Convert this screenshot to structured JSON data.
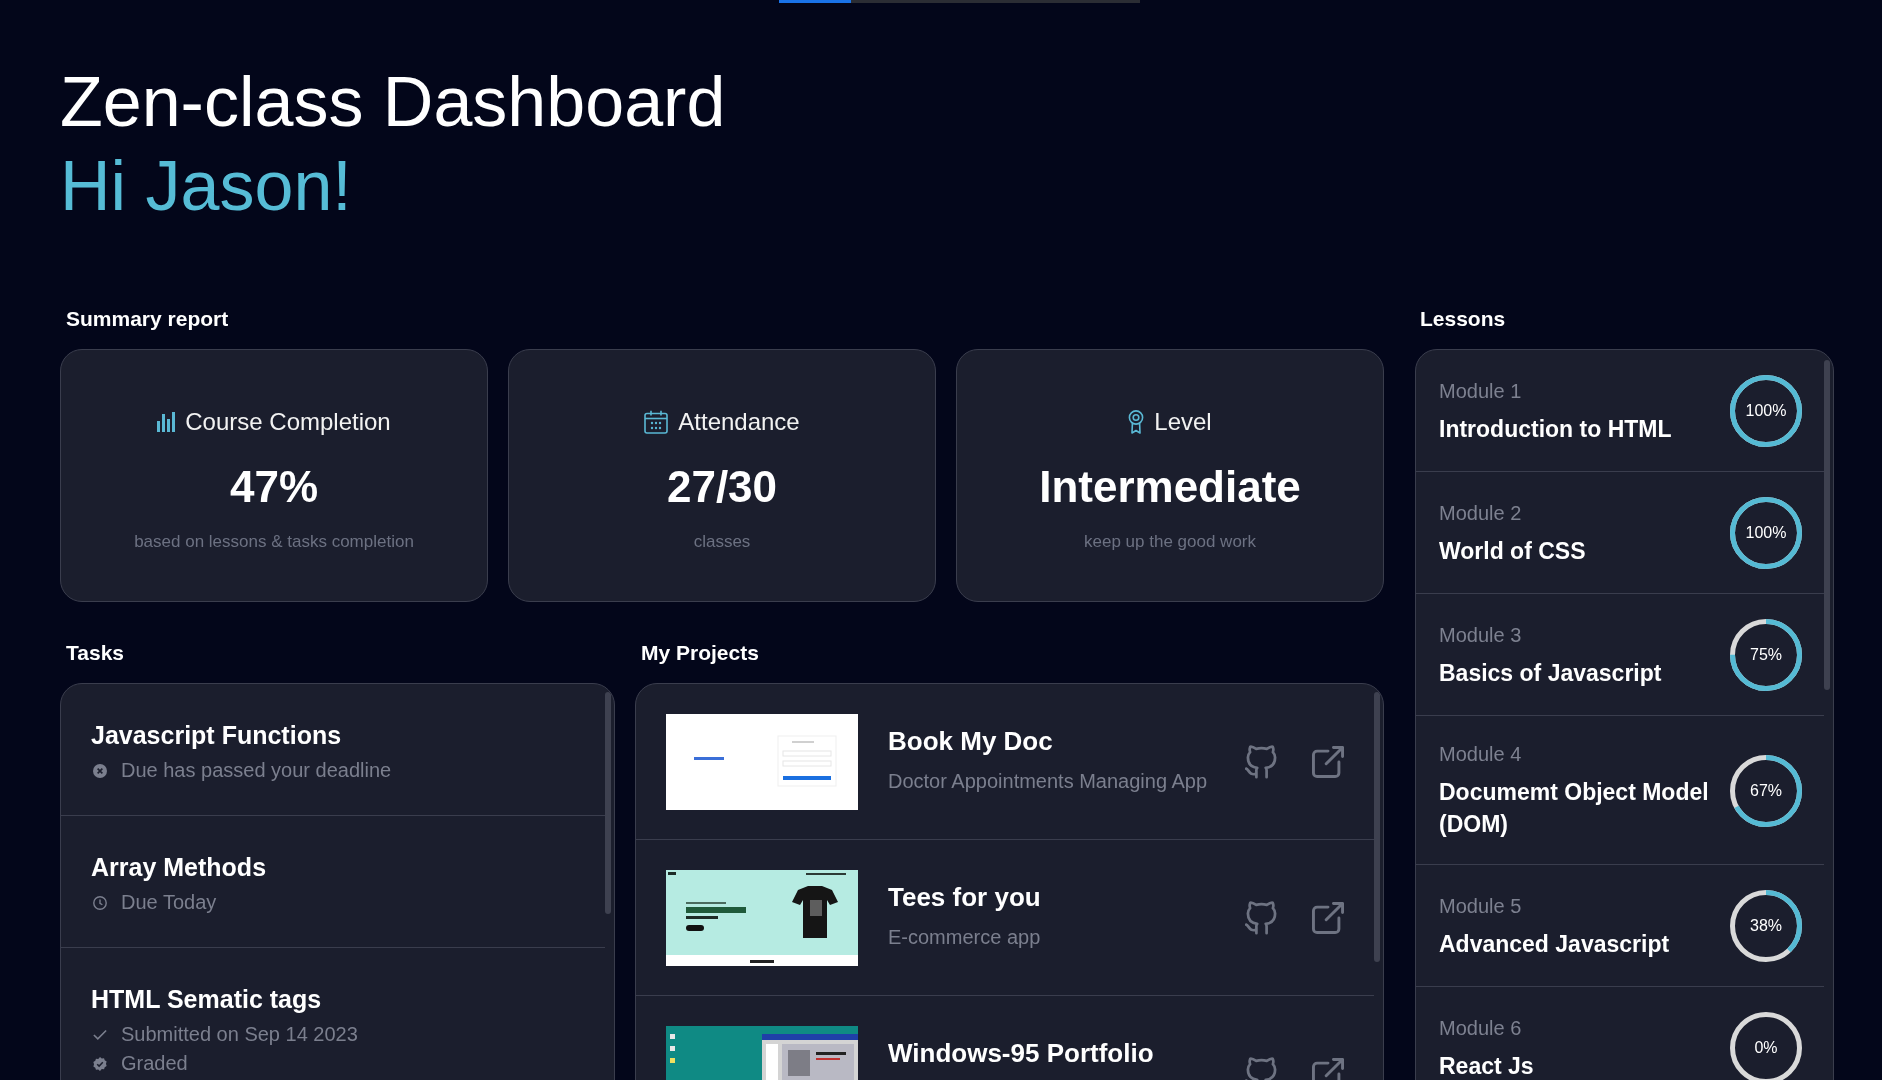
{
  "loading_bar": {
    "level": 0.2
  },
  "header": {
    "title": "Zen-class Dashboard",
    "greeting": "Hi Jason!"
  },
  "summary": {
    "heading": "Summary report",
    "cards": [
      {
        "kind": "completion",
        "label": "Course Completion",
        "value": "47%",
        "note": "based on lessons & tasks completion"
      },
      {
        "kind": "attendance",
        "label": "Attendance",
        "value": "27/30",
        "note": "classes"
      },
      {
        "kind": "level",
        "label": "Level",
        "value": "Intermediate",
        "note": "keep up the good work"
      }
    ]
  },
  "tasks": {
    "heading": "Tasks",
    "items": [
      {
        "title": "Javascript Functions",
        "status": [
          {
            "kind": "overdue",
            "text": "Due has passed your deadline"
          }
        ]
      },
      {
        "title": "Array Methods",
        "status": [
          {
            "kind": "due",
            "text": "Due Today"
          }
        ]
      },
      {
        "title": "HTML Sematic tags",
        "status": [
          {
            "kind": "submitted",
            "text": "Submitted on Sep 14 2023"
          },
          {
            "kind": "graded",
            "text": "Graded"
          }
        ]
      }
    ]
  },
  "projects": {
    "heading": "My Projects",
    "items": [
      {
        "kind": "form",
        "title": "Book My Doc",
        "description": "Doctor Appointments Managing App"
      },
      {
        "kind": "shop",
        "title": "Tees for you",
        "description": "E-commerce app"
      },
      {
        "kind": "desktop",
        "title": "Windows-95 Portfolio"
      }
    ]
  },
  "lessons": {
    "heading": "Lessons",
    "items": [
      {
        "module": "Module 1",
        "title": "Introduction to HTML",
        "level": 1,
        "progress": "100%"
      },
      {
        "module": "Module 2",
        "title": "World of CSS",
        "level": 1,
        "progress": "100%"
      },
      {
        "module": "Module 3",
        "title": "Basics of Javascript",
        "level": 0.75,
        "progress": "75%"
      },
      {
        "module": "Module 4",
        "title": "Documemt Object Model (DOM)",
        "level": 0.67,
        "progress": "67%"
      },
      {
        "module": "Module 5",
        "title": "Advanced Javascript",
        "level": 0.38,
        "progress": "38%"
      },
      {
        "module": "Module 6",
        "title": "React Js",
        "level": 0,
        "progress": "0%"
      }
    ]
  }
}
